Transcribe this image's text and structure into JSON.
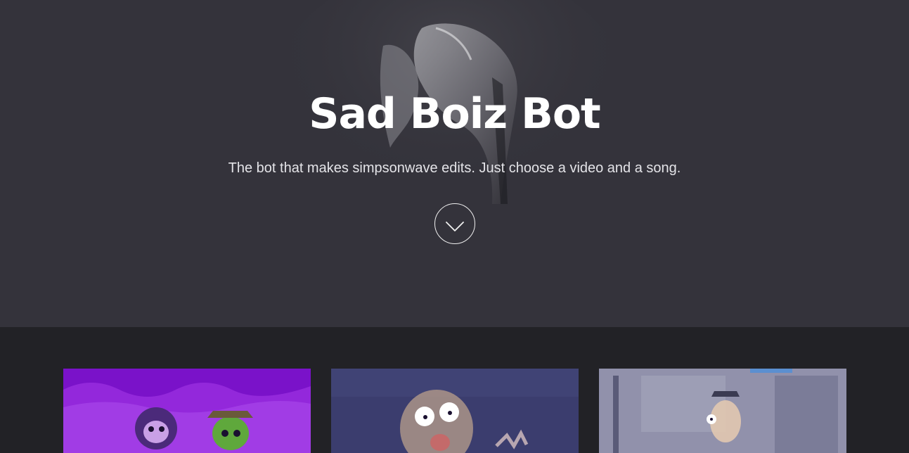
{
  "hero": {
    "title": "Sad Boiz Bot",
    "subtitle": "The bot that makes simpsonwave edits. Just choose a video and a song.",
    "scroll_icon": "chevron-down-icon"
  },
  "gallery": {
    "cards": [
      {
        "thumbnail": "teen-titans-thumbnail"
      },
      {
        "thumbnail": "rick-and-morty-thumbnail"
      },
      {
        "thumbnail": "phineas-and-ferb-thumbnail"
      }
    ]
  },
  "colors": {
    "hero_bg": "#34333b",
    "gallery_bg": "#222226",
    "title": "#ffffff",
    "subtitle": "#e4e4e8"
  }
}
